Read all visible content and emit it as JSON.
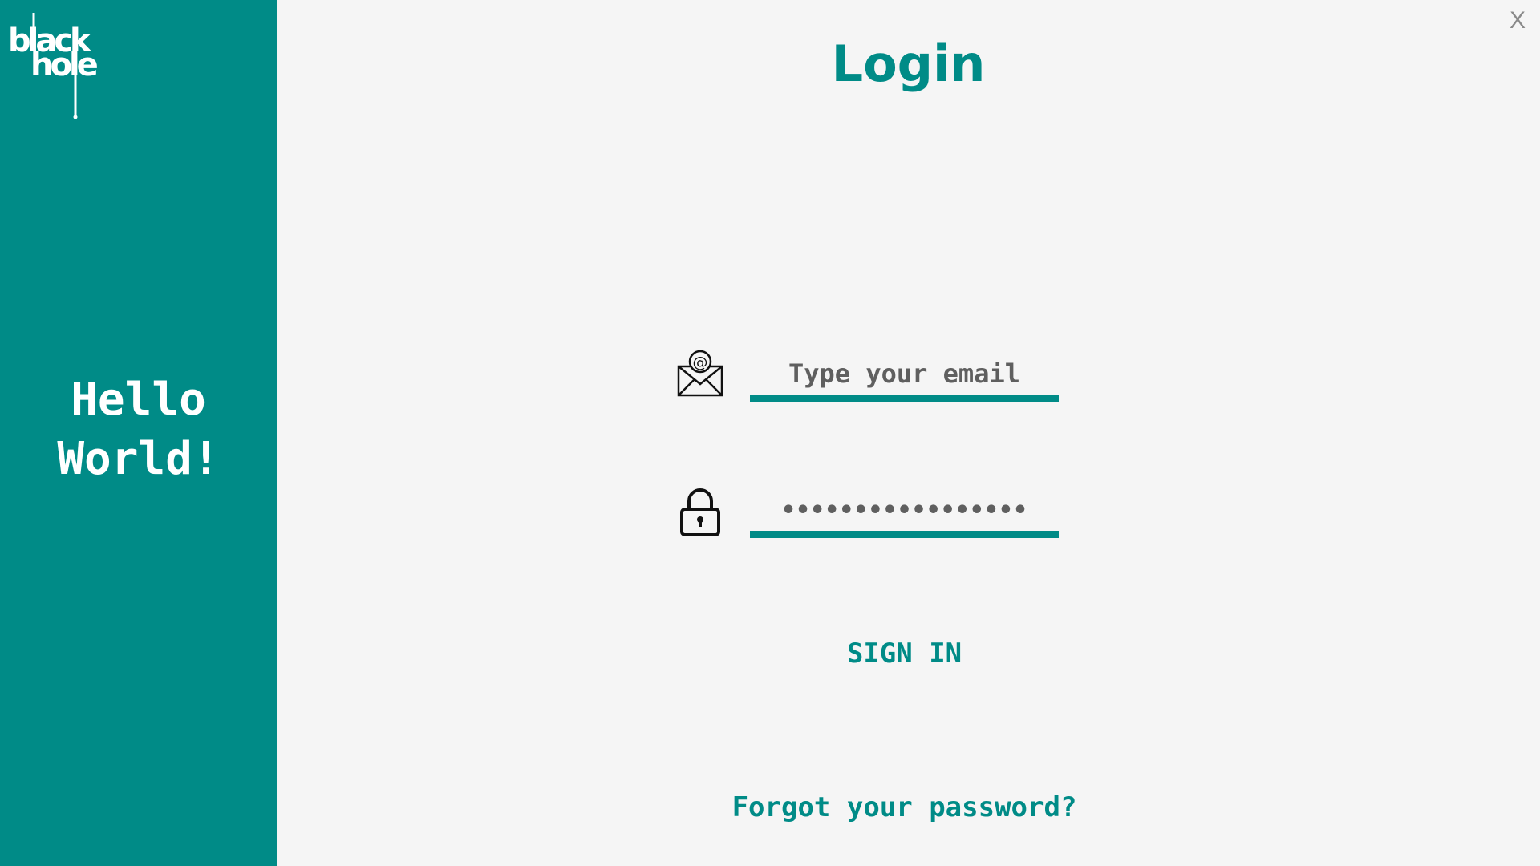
{
  "sidebar": {
    "logo": {
      "text_line1": "black",
      "text_line2": "hole"
    },
    "greeting": "Hello World!"
  },
  "window": {
    "close_label": "X"
  },
  "login": {
    "title": "Login",
    "email_field": {
      "placeholder": "Type your email",
      "value": "",
      "icon": "email-at-icon"
    },
    "password_field": {
      "value": "•••••••••••••••••",
      "icon": "lock-icon"
    },
    "signin_label": "SIGN IN",
    "forgot_label": "Forgot your password?"
  },
  "colors": {
    "accent": "#008b87",
    "background": "#f5f5f5",
    "field_text": "#5f5f5f",
    "close": "#8a8a8a"
  }
}
